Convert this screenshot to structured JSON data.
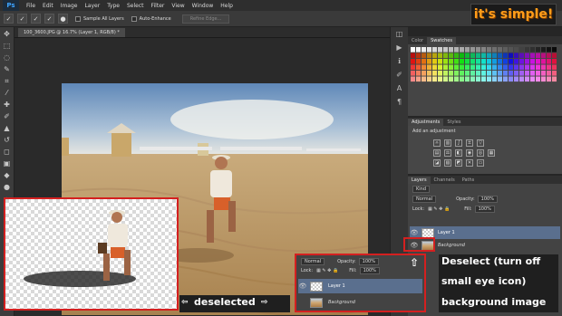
{
  "menu": {
    "logo": "Ps",
    "items": [
      "File",
      "Edit",
      "Image",
      "Layer",
      "Type",
      "Select",
      "Filter",
      "View",
      "Window",
      "Help"
    ]
  },
  "options": {
    "sample_all_layers": "Sample All Layers",
    "auto_enhance": "Auto-Enhance",
    "refine_edge": "Refine Edge..."
  },
  "brand": {
    "text": "it's simple!"
  },
  "document": {
    "tab_title": "100_3600.JPG @ 16.7% (Layer 1, RGB/8) *"
  },
  "panels": {
    "color_tab": "Color",
    "swatches_tab": "Swatches",
    "adjustments_tab": "Adjustments",
    "styles_tab": "Styles",
    "add_adjustment": "Add an adjustment",
    "layers_tab": "Layers",
    "channels_tab": "Channels",
    "paths_tab": "Paths",
    "kind": "Kind",
    "blend_mode": "Normal",
    "opacity_label": "Opacity:",
    "opacity_value": "100%",
    "lock_label": "Lock:",
    "fill_label": "Fill:",
    "fill_value": "100%",
    "layers": [
      {
        "name": "Layer 1"
      },
      {
        "name": "Background"
      }
    ]
  },
  "annotations": {
    "deselected": "deselected",
    "deselect_note_line1": "Deselect (turn off",
    "deselect_note_line2": "small eye icon)",
    "deselect_note_line3": "background image"
  },
  "colors": {
    "accent_red": "#d42020",
    "brand_orange": "#ff9d1a"
  }
}
